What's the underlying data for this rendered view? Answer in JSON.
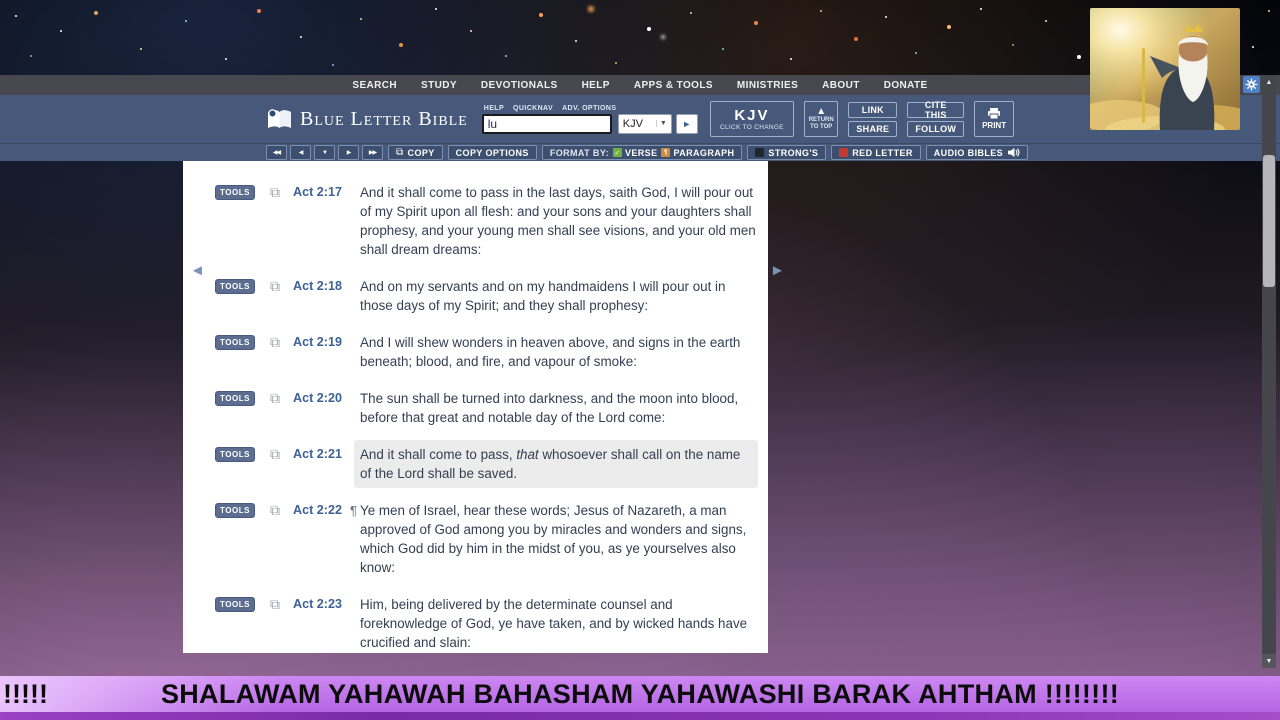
{
  "nav": {
    "items": [
      "SEARCH",
      "STUDY",
      "DEVOTIONALS",
      "HELP",
      "APPS & TOOLS",
      "MINISTRIES",
      "ABOUT",
      "DONATE"
    ]
  },
  "header": {
    "brand": "Blue Letter Bible",
    "mini_links": [
      "HELP",
      "QUICKNAV",
      "ADV. OPTIONS"
    ],
    "search_value": "lu",
    "version_select": "KJV",
    "version_panel": {
      "label": "KJV",
      "sublabel": "CLICK TO CHANGE"
    },
    "return_top_label": "RETURN TO TOP",
    "link_label": "LINK",
    "share_label": "SHARE",
    "cite_label": "CITE THIS",
    "follow_label": "FOLLOW",
    "print_label": "PRINT"
  },
  "toolbar": {
    "chapter_nav": [
      "first-chapter",
      "prev-chapter",
      "chapter-dropdown",
      "next-chapter",
      "last-chapter"
    ],
    "copy_label": "COPY",
    "copy_options_label": "COPY OPTIONS",
    "format_by_label": "FORMAT BY:",
    "verse_label": "VERSE",
    "paragraph_label": "PARAGRAPH",
    "strongs_label": "STRONG'S",
    "red_letter_label": "RED LETTER",
    "audio_label": "AUDIO BIBLES"
  },
  "content": {
    "tools_label": "TOOLS",
    "pilcrow": "¶",
    "verses": [
      {
        "ref": "Act 2:17",
        "pilcrow": false,
        "highlight": false,
        "parts": [
          {
            "text": "And it shall come to pass in the last days, saith God, I will pour out of my Spirit upon all flesh: and your sons and your daughters shall prophesy, and your young men shall see visions, and your old men shall dream dreams:"
          }
        ]
      },
      {
        "ref": "Act 2:18",
        "pilcrow": false,
        "highlight": false,
        "parts": [
          {
            "text": "And on my servants and on my handmaidens I will pour out in those days of my Spirit; and they shall prophesy:"
          }
        ]
      },
      {
        "ref": "Act 2:19",
        "pilcrow": false,
        "highlight": false,
        "parts": [
          {
            "text": "And I will shew wonders in heaven above, and signs in the earth beneath; blood, and fire, and vapour of smoke:"
          }
        ]
      },
      {
        "ref": "Act 2:20",
        "pilcrow": false,
        "highlight": false,
        "parts": [
          {
            "text": "The sun shall be turned into darkness, and the moon into blood, before that great and notable day of the Lord come:"
          }
        ]
      },
      {
        "ref": "Act 2:21",
        "pilcrow": false,
        "highlight": true,
        "parts": [
          {
            "text": "And it shall come to pass, "
          },
          {
            "text": "that",
            "italic": true
          },
          {
            "text": " whosoever shall call on the name of the Lord shall be saved."
          }
        ]
      },
      {
        "ref": "Act 2:22",
        "pilcrow": true,
        "highlight": false,
        "parts": [
          {
            "text": "Ye men of Israel, hear these words; Jesus of Nazareth, a man approved of God among you by miracles and wonders and signs, which God did by him in the midst of you, as ye yourselves also know:"
          }
        ]
      },
      {
        "ref": "Act 2:23",
        "pilcrow": false,
        "highlight": false,
        "parts": [
          {
            "text": "Him, being delivered by the determinate counsel and foreknowledge of God, ye have taken, and by wicked hands have crucified and slain:"
          }
        ]
      }
    ]
  },
  "banner": {
    "left_text": "!!!!!",
    "main_text": "SHALAWAM YAHAWAH BAHASHAM YAHAWASHI BARAK AHTHAM !!!!!!!!"
  },
  "colors": {
    "header_blue": "#47597b",
    "toolbar_button": "#3d4f6f",
    "banner_purple": "#c47ceb",
    "highlight_gray": "#ececec",
    "verse_ref_blue": "#3e6293",
    "verse_green_icon": "#6fb043",
    "paragraph_orange_icon": "#d08a3e",
    "red_letter_icon": "#c23b2e"
  }
}
